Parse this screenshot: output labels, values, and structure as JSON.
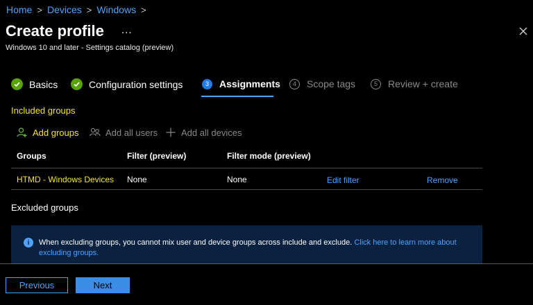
{
  "breadcrumb": [
    "Home",
    "Devices",
    "Windows"
  ],
  "header": {
    "title": "Create profile",
    "more": "...",
    "subtitle": "Windows 10 and later - Settings catalog (preview)"
  },
  "steps": [
    {
      "label": "Basics",
      "state": "complete"
    },
    {
      "label": "Configuration settings",
      "state": "complete"
    },
    {
      "number": "3",
      "label": "Assignments",
      "state": "active"
    },
    {
      "number": "4",
      "label": "Scope tags",
      "state": "inactive"
    },
    {
      "number": "5",
      "label": "Review + create",
      "state": "inactive"
    }
  ],
  "included": {
    "heading": "Included groups",
    "actions": {
      "add_groups": "Add groups",
      "add_all_users": "Add all users",
      "add_all_devices": "Add all devices"
    },
    "columns": [
      "Groups",
      "Filter (preview)",
      "Filter mode (preview)"
    ],
    "rows": [
      {
        "group": "HTMD - Windows Devices",
        "filter": "None",
        "filter_mode": "None",
        "edit": "Edit filter",
        "remove": "Remove"
      }
    ]
  },
  "excluded": {
    "heading": "Excluded groups",
    "info_text": "When excluding groups, you cannot mix user and device groups across include and exclude.",
    "info_link": "Click here to learn more about excluding groups."
  },
  "footer": {
    "previous": "Previous",
    "next": "Next"
  },
  "colors": {
    "accent": "#4da3ff",
    "highlight": "#f5e61f",
    "success": "#57a300",
    "info_bg": "#0a2140"
  }
}
